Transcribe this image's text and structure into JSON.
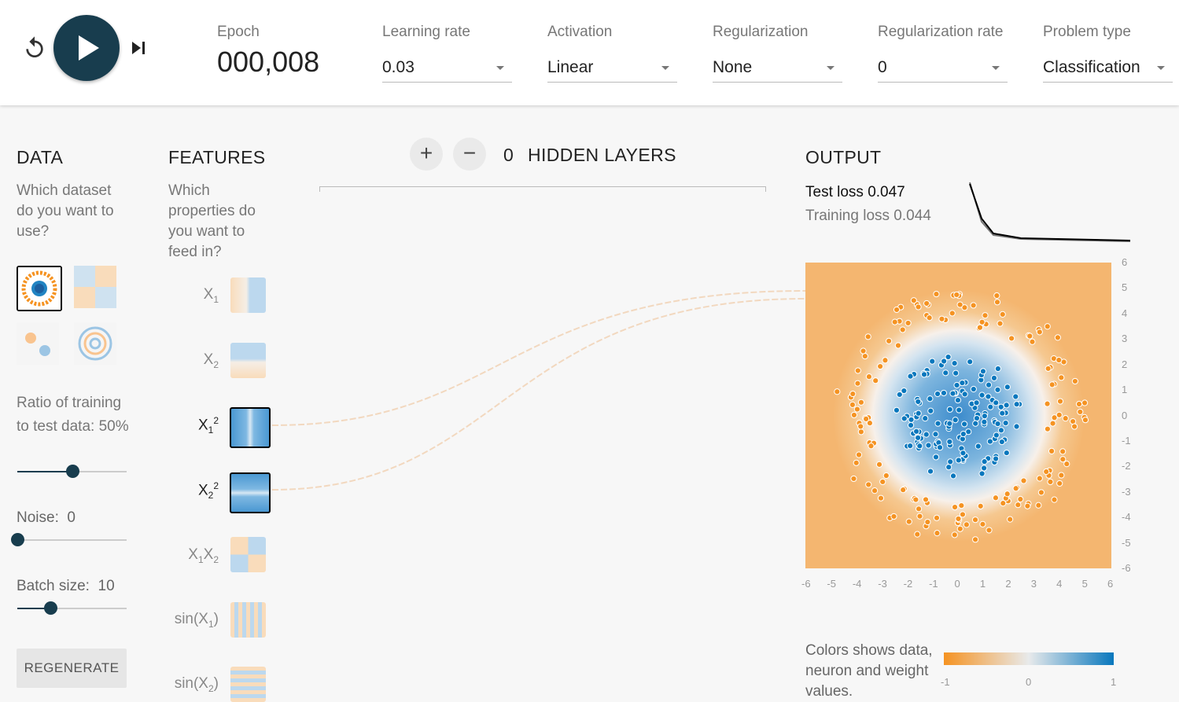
{
  "controls": {
    "epoch_label": "Epoch",
    "epoch_value": "000,008",
    "learning_rate": {
      "label": "Learning rate",
      "value": "0.03"
    },
    "activation": {
      "label": "Activation",
      "value": "Linear"
    },
    "regularization": {
      "label": "Regularization",
      "value": "None"
    },
    "regularization_rate": {
      "label": "Regularization rate",
      "value": "0"
    },
    "problem_type": {
      "label": "Problem type",
      "value": "Classification"
    }
  },
  "data_panel": {
    "title": "DATA",
    "question": "Which dataset do you want to use?",
    "ratio_label": "Ratio of training to test data:",
    "ratio_value": "50%",
    "ratio_fraction": 0.5,
    "noise_label": "Noise:",
    "noise_value": "0",
    "noise_fraction": 0,
    "batch_label": "Batch size:",
    "batch_value": "10",
    "batch_fraction": 0.3,
    "regenerate_label": "REGENERATE"
  },
  "features_panel": {
    "title": "FEATURES",
    "question": "Which properties do you want to feed in?",
    "features": [
      {
        "id": "x1",
        "label": "X1",
        "active": false
      },
      {
        "id": "x2",
        "label": "X2",
        "active": false
      },
      {
        "id": "x1sq",
        "label": "X1^2",
        "active": true
      },
      {
        "id": "x2sq",
        "label": "X2^2",
        "active": true
      },
      {
        "id": "x1x2",
        "label": "X1X2",
        "active": false
      },
      {
        "id": "sinx1",
        "label": "sin(X1)",
        "active": false
      },
      {
        "id": "sinx2",
        "label": "sin(X2)",
        "active": false
      }
    ]
  },
  "network": {
    "add_layer": "+",
    "remove_layer": "−",
    "hidden_count": "0",
    "hidden_label": "HIDDEN LAYERS"
  },
  "output": {
    "title": "OUTPUT",
    "test_loss_label": "Test loss",
    "test_loss_value": "0.047",
    "train_loss_label": "Training loss",
    "train_loss_value": "0.044",
    "axis_ticks": [
      "-6",
      "-5",
      "-4",
      "-3",
      "-2",
      "-1",
      "0",
      "1",
      "2",
      "3",
      "4",
      "5",
      "6"
    ],
    "legend_text": "Colors shows data, neuron and weight values.",
    "legend_ticks": [
      "-1",
      "0",
      "1"
    ]
  },
  "colors": {
    "orange": "#f59322",
    "blue": "#0877bd",
    "dark": "#183d4e"
  }
}
